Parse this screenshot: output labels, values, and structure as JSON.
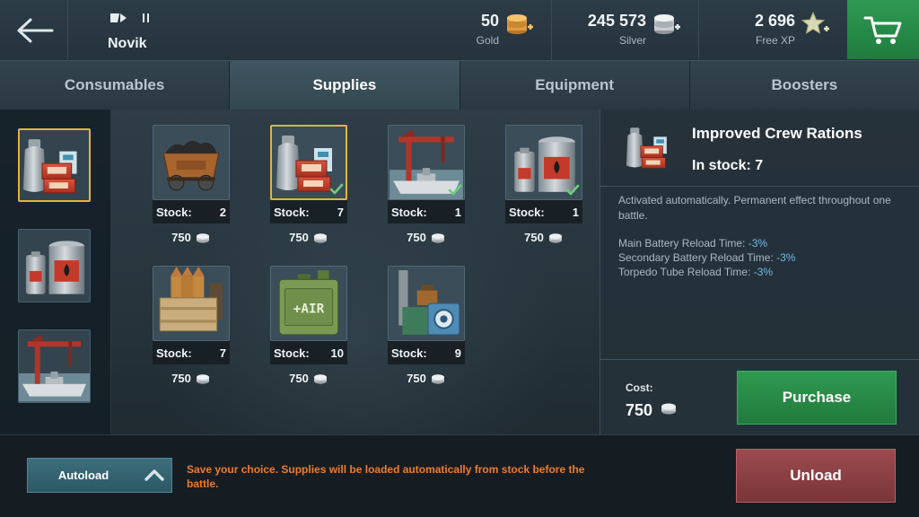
{
  "topbar": {
    "ship_name": "Novik",
    "gold": {
      "amount": "50",
      "label": "Gold"
    },
    "silver": {
      "amount": "245 573",
      "label": "Silver"
    },
    "free_xp": {
      "amount": "2 696",
      "label": "Free XP"
    }
  },
  "tabs": [
    {
      "label": "Consumables",
      "active": false
    },
    {
      "label": "Supplies",
      "active": true
    },
    {
      "label": "Equipment",
      "active": false
    },
    {
      "label": "Boosters",
      "active": false
    }
  ],
  "equipped_slots": [
    {
      "item": "crew-rations",
      "selected": true
    },
    {
      "item": "fuel-tanks",
      "selected": false
    },
    {
      "item": "crane-ship",
      "selected": false
    }
  ],
  "supplies": [
    {
      "item": "coal-cart",
      "stock_label": "Stock:",
      "stock": "2",
      "price": "750",
      "equipped": false,
      "selected": false
    },
    {
      "item": "crew-rations",
      "stock_label": "Stock:",
      "stock": "7",
      "price": "750",
      "equipped": true,
      "selected": true
    },
    {
      "item": "crane-ship",
      "stock_label": "Stock:",
      "stock": "1",
      "price": "750",
      "equipped": true,
      "selected": false
    },
    {
      "item": "fuel-tanks",
      "stock_label": "Stock:",
      "stock": "1",
      "price": "750",
      "equipped": true,
      "selected": false
    },
    {
      "item": "ammo-crate",
      "stock_label": "Stock:",
      "stock": "7",
      "price": "750",
      "equipped": false,
      "selected": false
    },
    {
      "item": "air-jerrycan",
      "stock_label": "Stock:",
      "stock": "10",
      "price": "750",
      "equipped": false,
      "selected": false
    },
    {
      "item": "machinery",
      "stock_label": "Stock:",
      "stock": "9",
      "price": "750",
      "equipped": false,
      "selected": false
    }
  ],
  "details": {
    "title": "Improved Crew Rations",
    "in_stock": "In stock: 7",
    "description": "Activated automatically. Permanent effect throughout one battle.",
    "effects": [
      {
        "label": "Main Battery Reload Time: ",
        "value": "-3%"
      },
      {
        "label": "Secondary Battery Reload Time: ",
        "value": "-3%"
      },
      {
        "label": "Torpedo Tube Reload Time: ",
        "value": "-3%"
      }
    ],
    "cost_label": "Cost:",
    "cost": "750",
    "purchase_label": "Purchase"
  },
  "footer": {
    "autoload_label": "Autoload",
    "notice": "Save your choice. Supplies will be loaded automatically from stock before the battle.",
    "unload_label": "Unload"
  },
  "colors": {
    "accent_green": "#2f9a50",
    "unload_red": "#8a4043",
    "selection_gold": "#e6b23a",
    "effect_blue": "#6fb9e8",
    "warning_orange": "#f07a2c"
  },
  "icons": [
    "back-arrow-icon",
    "flag-icon",
    "tier-icon",
    "gold-coins-icon",
    "silver-coins-icon",
    "free-xp-star-icon",
    "shopping-cart-icon",
    "silver-coin-icon",
    "check-icon",
    "chevron-up-icon"
  ]
}
